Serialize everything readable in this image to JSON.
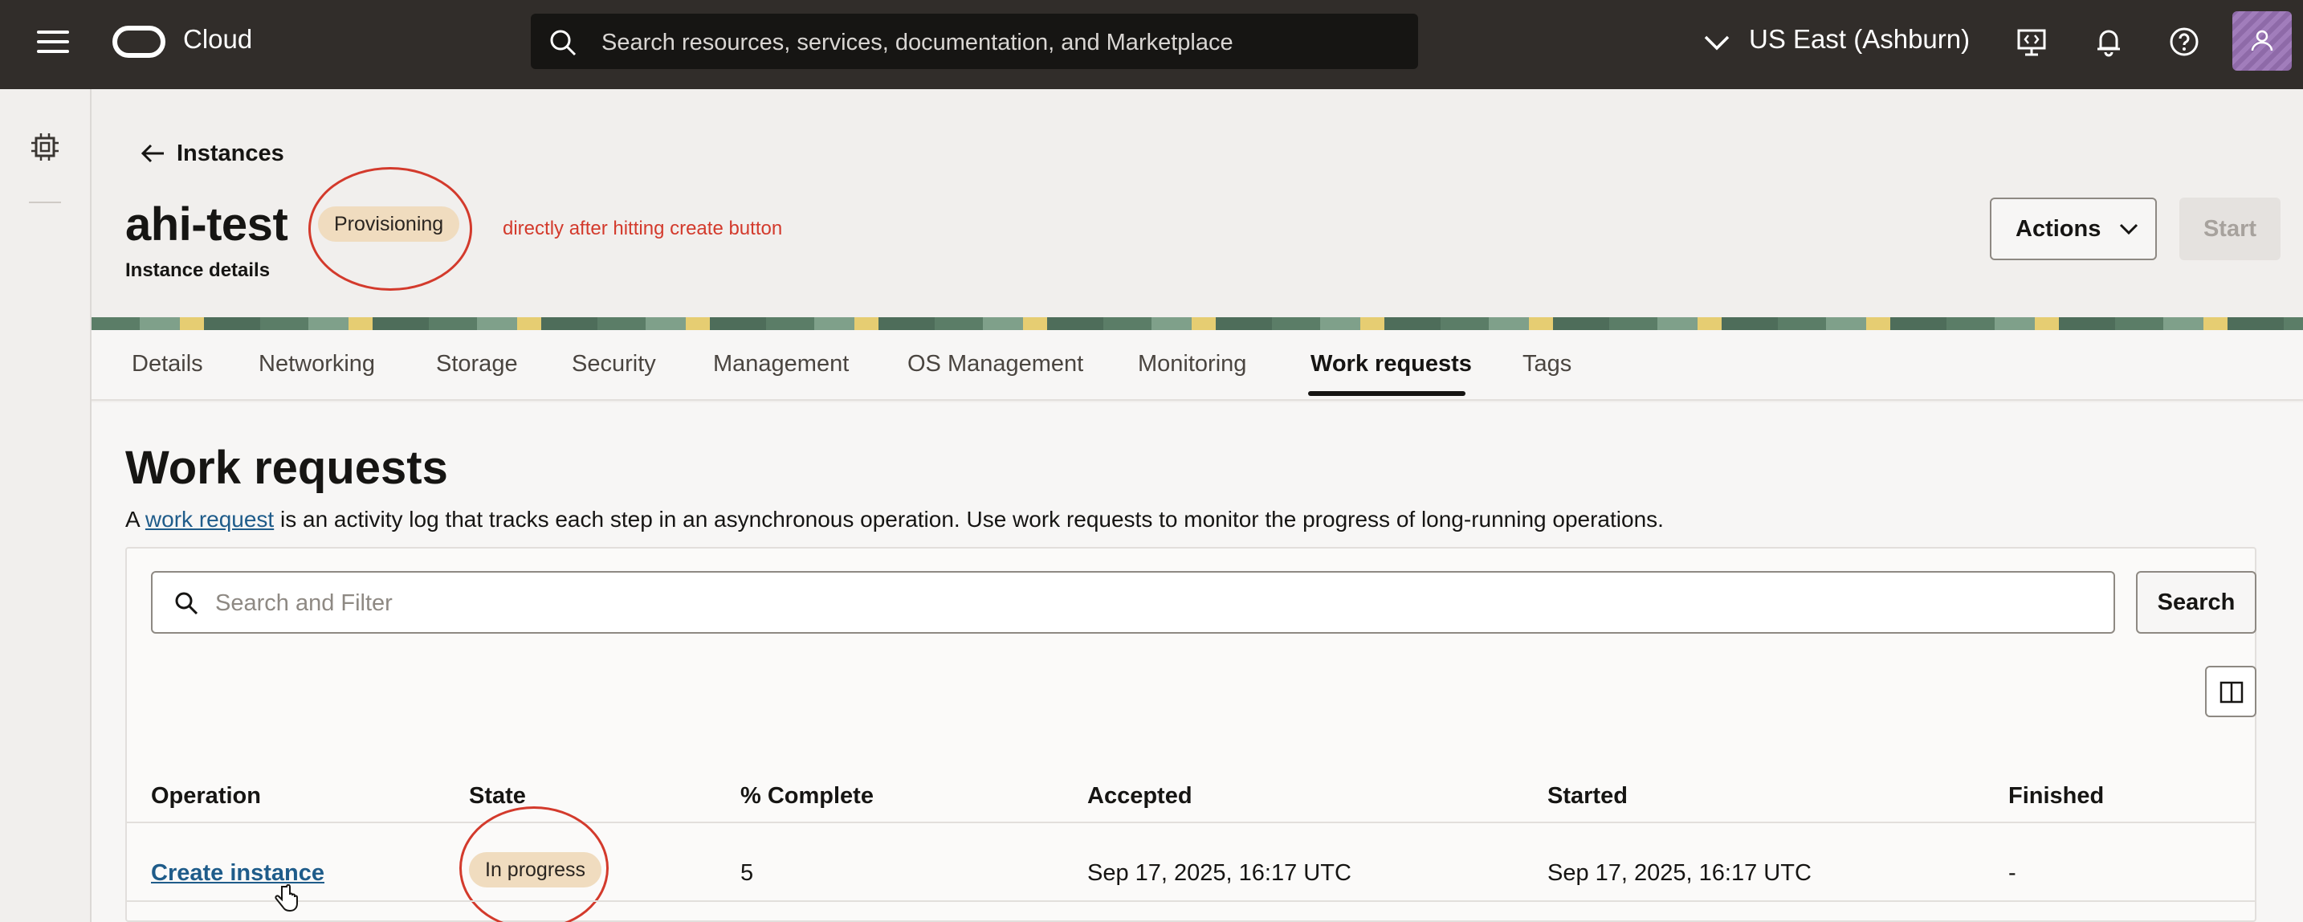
{
  "topbar": {
    "brand": "Cloud",
    "search_placeholder": "Search resources, services, documentation, and Marketplace",
    "region": "US East (Ashburn)",
    "icons": [
      "menu-icon",
      "cloud-logo-icon",
      "search-icon",
      "chevron-down-icon",
      "code-editor-icon",
      "bell-icon",
      "help-icon",
      "user-icon"
    ],
    "colors": {
      "bar": "#312d2a",
      "search": "#161513"
    }
  },
  "breadcrumb": {
    "back_label": "Instances"
  },
  "header": {
    "title": "ahi-test",
    "status": "Provisioning",
    "annotation": "directly after hitting create button",
    "subtitle": "Instance details",
    "actions_label": "Actions",
    "start_label": "Start"
  },
  "tabs": [
    {
      "label": "Details"
    },
    {
      "label": "Networking"
    },
    {
      "label": "Storage"
    },
    {
      "label": "Security"
    },
    {
      "label": "Management"
    },
    {
      "label": "OS Management"
    },
    {
      "label": "Monitoring"
    },
    {
      "label": "Work requests",
      "active": true
    },
    {
      "label": "Tags"
    }
  ],
  "work_requests": {
    "heading": "Work requests",
    "desc_prefix": "A ",
    "desc_link": "work request",
    "desc_suffix": " is an activity log that tracks each step in an asynchronous operation. Use work requests to monitor the progress of long-running operations.",
    "filter_placeholder": "Search and Filter",
    "search_label": "Search",
    "columns": [
      "Operation",
      "State",
      "% Complete",
      "Accepted",
      "Started",
      "Finished"
    ],
    "rows": [
      {
        "operation": "Create instance",
        "state": "In progress",
        "complete": "5",
        "accepted": "Sep 17, 2025, 16:17 UTC",
        "started": "Sep 17, 2025, 16:17 UTC",
        "finished": "-"
      }
    ]
  },
  "colors": {
    "annotation": "#d33a2c",
    "link": "#1f5c8a",
    "badge": "#f0dcbf"
  }
}
